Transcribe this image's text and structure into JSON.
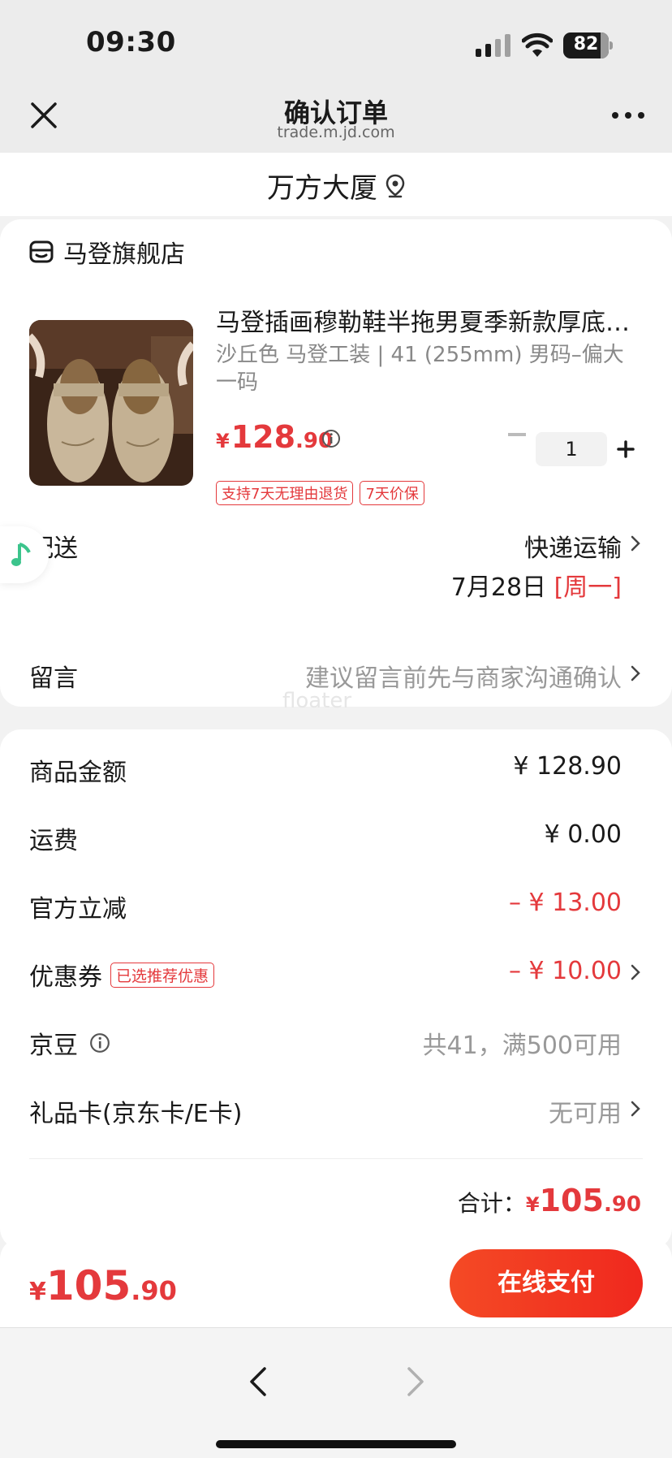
{
  "status_bar": {
    "time": "09:30",
    "battery_percent": "82",
    "battery_level": 0.82,
    "icons": [
      "cellular-signal-icon",
      "wifi-icon",
      "battery-icon"
    ]
  },
  "nav": {
    "title": "确认订单",
    "subtitle": "trade.m.jd.com",
    "icons": [
      "close-icon",
      "more-icon"
    ]
  },
  "address": {
    "text": "万方大厦",
    "icon": "location-pin-icon"
  },
  "store": {
    "name": "马登旗舰店",
    "icon": "store-icon"
  },
  "product": {
    "title": "马登插画穆勒鞋半拖男夏季新款厚底…",
    "spec": "沙丘色 马登工装 | 41 (255mm) 男码–偏大一码",
    "price_yen": "¥",
    "price_int": "128",
    "price_dec": ".90",
    "quantity": "1",
    "tags": [
      "支持7天无理由退货",
      "7天价保"
    ]
  },
  "delivery": {
    "label": "配送",
    "method": "快递运输",
    "date": "7月28日",
    "weekday": "[周一]"
  },
  "message": {
    "label": "留言",
    "placeholder": "建议留言前先与商家沟通确认"
  },
  "watermark": "floater",
  "summary": {
    "goods_label": "商品金额",
    "goods_value": "¥ 128.90",
    "shipping_label": "运费",
    "shipping_value": "¥ 0.00",
    "discount_label": "官方立减",
    "discount_value": "– ¥ 13.00",
    "coupon_label": "优惠券",
    "coupon_badge": "已选推荐优惠",
    "coupon_value": "– ¥ 10.00",
    "beans_label": "京豆",
    "beans_value": "共41，满500可用",
    "giftcard_label": "礼品卡(京东卡/E卡)",
    "giftcard_value": "无可用",
    "total_label": "合计：",
    "total_yen": "¥",
    "total_int": "105",
    "total_dec": ".90"
  },
  "paybar": {
    "price_yen": "¥",
    "price_int": "105",
    "price_dec": ".90",
    "button": "在线支付"
  },
  "colors": {
    "accent_red": "#e4393c",
    "pay_button": "#f0281e",
    "background": "#f2f2f2"
  }
}
